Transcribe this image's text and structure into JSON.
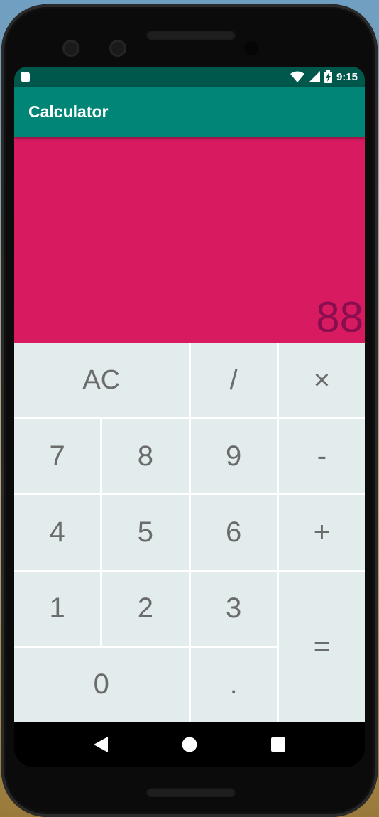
{
  "status_bar": {
    "time": "9:15"
  },
  "app_bar": {
    "title": "Calculator"
  },
  "display": {
    "value": "88"
  },
  "keys": {
    "clear": "AC",
    "divide": "/",
    "multiply": "×",
    "seven": "7",
    "eight": "8",
    "nine": "9",
    "minus": "-",
    "four": "4",
    "five": "5",
    "six": "6",
    "plus": "+",
    "one": "1",
    "two": "2",
    "three": "3",
    "equals": "=",
    "zero": "0",
    "decimal": "."
  },
  "colors": {
    "status_bar": "#00574b",
    "app_bar": "#008577",
    "display_bg": "#d81b60",
    "display_text": "#880e4f",
    "key_bg": "#e2ecec",
    "key_text": "#6b6b6b"
  },
  "navigation": {
    "icons": [
      "back-icon",
      "home-icon",
      "recents-icon"
    ]
  }
}
